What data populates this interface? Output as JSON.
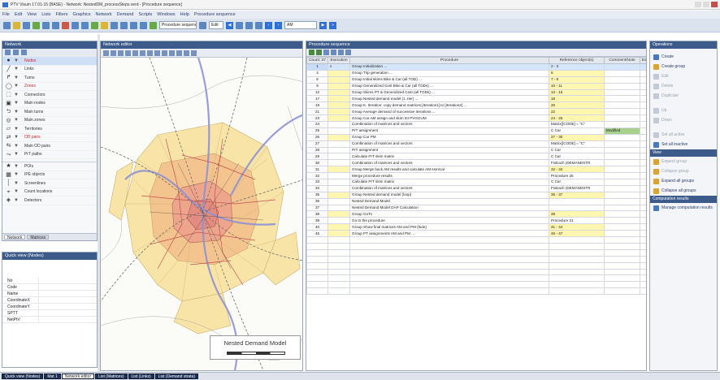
{
  "window": {
    "title": "PTV Visum 17.01-15 (BASE) - Network: NestedDM_processSteps.verd - [Procedure sequence]",
    "controls": [
      "minimize",
      "maximize",
      "close"
    ]
  },
  "menu": [
    "File",
    "Edit",
    "View",
    "Lists",
    "Filters",
    "Graphics",
    "Network",
    "Demand",
    "Scripts",
    "Windows",
    "Help",
    "Procedure sequence"
  ],
  "toolbar": {
    "combo_procedure": "Procedure sequence",
    "combo_small": "Edit",
    "combo_time": "AM"
  },
  "network_panel": {
    "title": "Network",
    "items": [
      {
        "icon": "node-icon",
        "label": "Nodes",
        "selected": true
      },
      {
        "icon": "link-icon",
        "label": "Links"
      },
      {
        "icon": "turn-icon",
        "label": "Turns"
      },
      {
        "icon": "zone-icon",
        "label": "Zones"
      },
      {
        "icon": "connector-icon",
        "label": "Connectors"
      },
      {
        "icon": "main-node-icon",
        "label": "Main nodes"
      },
      {
        "icon": "main-turn-icon",
        "label": "Main turns"
      },
      {
        "icon": "main-zone-icon",
        "label": "Main zones"
      },
      {
        "icon": "territory-icon",
        "label": "Territories"
      },
      {
        "icon": "od-pair-icon",
        "label": "OD pairs"
      },
      {
        "icon": "main-od-pair-icon",
        "label": "Main OD pairs"
      },
      {
        "icon": "pr-path-icon",
        "label": "PrT paths"
      },
      {
        "icon": "poi-icon",
        "label": "POIs"
      },
      {
        "icon": "ipe-link-icon",
        "label": "IPE objects"
      },
      {
        "icon": "screenline-icon",
        "label": "Screenlines"
      },
      {
        "icon": "count-location-icon",
        "label": "Count locations"
      },
      {
        "icon": "detector-icon",
        "label": "Detectors"
      }
    ],
    "tabs": [
      "Network",
      "Matrices"
    ]
  },
  "quick_view": {
    "title": "Quick view (Nodes)",
    "rows": [
      "No",
      "Code",
      "Name",
      "CoordinateX",
      "CoordinateY",
      "SPTT",
      "NetPtV"
    ]
  },
  "network_editor": {
    "title": "Network editor",
    "legend_title": "Nested Demand Model"
  },
  "procedure_sequence": {
    "title": "Procedure sequence",
    "columns": [
      "Count: 37",
      "Execution",
      "Procedure",
      "Reference object(s)",
      "Comment/Note",
      "Ex"
    ],
    "rows": [
      {
        "no": "1",
        "exec": "x",
        "proc": "Group Initialization ...",
        "ref": "2 - 3",
        "note": "",
        "hl": true
      },
      {
        "no": "4",
        "exec": "",
        "proc": "Group Trip generation ...",
        "ref": "5",
        "note": ""
      },
      {
        "no": "6",
        "exec": "",
        "proc": "Group Initial skims Bike & Car (all TOD) ...",
        "ref": "7 - 8",
        "note": ""
      },
      {
        "no": "9",
        "exec": "",
        "proc": "Group Generalized Cost Bike & Car (all TODs) ...",
        "ref": "10 - 11",
        "note": ""
      },
      {
        "no": "12",
        "exec": "",
        "proc": "Group Skims PT & Generalized Cost (all TODs) ...",
        "ref": "13 - 16",
        "note": ""
      },
      {
        "no": "17",
        "exec": "",
        "proc": "Group Nested demand model (1. Iter) ...",
        "ref": "18",
        "note": ""
      },
      {
        "no": "19",
        "exec": "",
        "proc": "Group K. Iteration: copy demand matrices [Iteration1] to [Iteration2] ...",
        "ref": "20",
        "note": ""
      },
      {
        "no": "21",
        "exec": "",
        "proc": "Group Average demand of successive iterations ...",
        "ref": "22",
        "note": ""
      },
      {
        "no": "23",
        "exec": "",
        "proc": "Group Car AM assign and skim IIII PVGGUM",
        "ref": "24 - 25",
        "note": ""
      },
      {
        "no": "24",
        "exec": "",
        "proc": "Combination of matrices and vectors",
        "ref": "Matrix([CODE] = \"C\"",
        "note": "",
        "exoff": true,
        "refoff": true
      },
      {
        "no": "25",
        "exec": "",
        "proc": "PrT assignment",
        "ref": "C Car",
        "note": "Modified",
        "green": true,
        "exoff": true,
        "refoff": true
      },
      {
        "no": "26",
        "exec": "",
        "proc": "Group Car PM",
        "ref": "27 - 30",
        "note": ""
      },
      {
        "no": "27",
        "exec": "",
        "proc": "Combination of matrices and vectors",
        "ref": "Matrix([CODE] = \"C\"",
        "note": "",
        "exoff": true,
        "refoff": true
      },
      {
        "no": "28",
        "exec": "",
        "proc": "PrT assignment",
        "ref": "C Car",
        "note": "",
        "exoff": true,
        "refoff": true
      },
      {
        "no": "29",
        "exec": "",
        "proc": "Calculate PrT skim matrix",
        "ref": "C Car",
        "note": "",
        "exoff": true,
        "refoff": true
      },
      {
        "no": "30",
        "exec": "",
        "proc": "Combination of matrices and vectors",
        "ref": "FixEach (DEMANDSTR",
        "note": "",
        "exoff": true,
        "refoff": true
      },
      {
        "no": "31",
        "exec": "",
        "proc": "Group Merge back AM results and calculate AM ssm/car",
        "ref": "32 - 34",
        "note": ""
      },
      {
        "no": "32",
        "exec": "",
        "proc": "Merge procedure results",
        "ref": "Procedure 25",
        "note": "",
        "exoff": true,
        "refoff": true
      },
      {
        "no": "33",
        "exec": "",
        "proc": "Calculate PrT skim matrix",
        "ref": "C Car",
        "note": "",
        "exoff": true,
        "refoff": true
      },
      {
        "no": "34",
        "exec": "",
        "proc": "Combination of matrices and vectors",
        "ref": "FixEach (DEMANDSTR",
        "note": "",
        "exoff": true,
        "refoff": true
      },
      {
        "no": "35",
        "exec": "",
        "proc": "Group Nested demand model (loop)",
        "ref": "36 - 37",
        "note": ""
      },
      {
        "no": "36",
        "exec": "",
        "proc": "Nested Demand Model",
        "ref": "",
        "note": "",
        "exoff": true,
        "refoff": true
      },
      {
        "no": "37",
        "exec": "",
        "proc": "Nested Demand Model DAP Calculation",
        "ref": "",
        "note": "",
        "exoff": true,
        "refoff": true
      },
      {
        "no": "38",
        "exec": "",
        "proc": "Group GoTo",
        "ref": "39",
        "note": ""
      },
      {
        "no": "39",
        "exec": "",
        "proc": "Go to the procedure",
        "ref": "Procedure 21",
        "note": "",
        "exoff": true,
        "refoff": true
      },
      {
        "no": "40",
        "exec": "",
        "proc": "Group Show final matrices AM and PM (hide)",
        "ref": "41 - 44",
        "note": ""
      },
      {
        "no": "45",
        "exec": "",
        "proc": "Group PT assignments AM and PM ...",
        "ref": "46 - 47",
        "note": ""
      }
    ]
  },
  "operations": {
    "title": "Operations",
    "items": [
      {
        "label": "Create",
        "enabled": true
      },
      {
        "label": "Create group",
        "enabled": true
      },
      {
        "label": "Edit",
        "enabled": false
      },
      {
        "label": "Delete",
        "enabled": false
      },
      {
        "label": "Duplicate",
        "enabled": false
      },
      {
        "label": "Up",
        "enabled": false
      },
      {
        "label": "Down",
        "enabled": false
      },
      {
        "label": "Set all active",
        "enabled": false
      },
      {
        "label": "Set all inactive",
        "enabled": true
      }
    ],
    "view_title": "View",
    "view_items": [
      {
        "label": "Expand group",
        "enabled": false
      },
      {
        "label": "Collapse group",
        "enabled": false
      },
      {
        "label": "Expand all groups",
        "enabled": true
      },
      {
        "label": "Collapse all groups",
        "enabled": true
      }
    ],
    "comp_title": "Computation results",
    "comp_items": [
      {
        "label": "Manage computation results",
        "enabled": true
      }
    ]
  },
  "bottom_tabs": [
    "Quick view (Nodes)",
    "Mat 1",
    "Network editor",
    "List (Matrices)",
    "List (Links)",
    "List (Demand strata)"
  ]
}
